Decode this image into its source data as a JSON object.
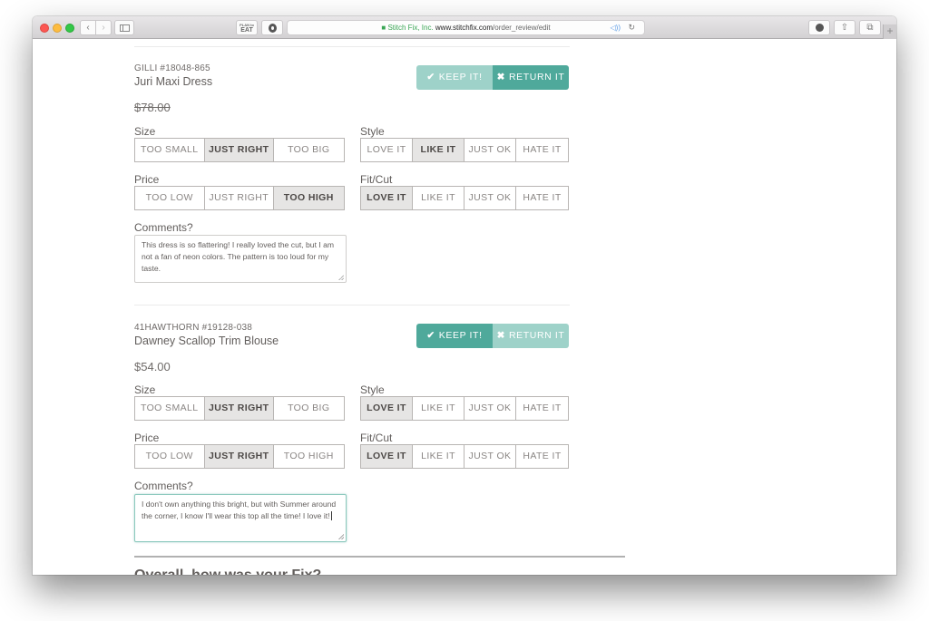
{
  "browser": {
    "address": {
      "company": "Stitch Fix, Inc.",
      "domain": "www.stitchfix.com",
      "path": "/order_review/edit"
    },
    "extension_eat_label": "EAT",
    "extension_eat_small": "PLAN to",
    "icons": {
      "back": "‹",
      "forward": "›",
      "audio": "◁))",
      "reload": "↻",
      "share": "⇧",
      "tabs": "⧉",
      "new_tab": "+",
      "lock": "🔒"
    }
  },
  "items": [
    {
      "sku": "GILLI #18048-865",
      "name": "Juri Maxi Dress",
      "price": "$78.00",
      "price_struck": true,
      "decision": "return",
      "keep_label": "KEEP IT!",
      "return_label": "RETURN IT",
      "size": {
        "label": "Size",
        "options": [
          "TOO SMALL",
          "JUST RIGHT",
          "TOO BIG"
        ],
        "selected": "JUST RIGHT"
      },
      "price_rating": {
        "label": "Price",
        "options": [
          "TOO LOW",
          "JUST RIGHT",
          "TOO HIGH"
        ],
        "selected": "TOO HIGH"
      },
      "style": {
        "label": "Style",
        "options": [
          "LOVE IT",
          "LIKE IT",
          "JUST OK",
          "HATE IT"
        ],
        "selected": "LIKE IT"
      },
      "fit": {
        "label": "Fit/Cut",
        "options": [
          "LOVE IT",
          "LIKE IT",
          "JUST OK",
          "HATE IT"
        ],
        "selected": "LOVE IT"
      },
      "comments_label": "Comments?",
      "comments": "This dress is so flattering! I really loved the cut, but I am not a fan of neon colors. The pattern is too loud for my taste."
    },
    {
      "sku": "41HAWTHORN #19128-038",
      "name": "Dawney Scallop Trim Blouse",
      "price": "$54.00",
      "price_struck": false,
      "decision": "keep",
      "keep_label": "KEEP IT!",
      "return_label": "RETURN IT",
      "size": {
        "label": "Size",
        "options": [
          "TOO SMALL",
          "JUST RIGHT",
          "TOO BIG"
        ],
        "selected": "JUST RIGHT"
      },
      "price_rating": {
        "label": "Price",
        "options": [
          "TOO LOW",
          "JUST RIGHT",
          "TOO HIGH"
        ],
        "selected": "JUST RIGHT"
      },
      "style": {
        "label": "Style",
        "options": [
          "LOVE IT",
          "LIKE IT",
          "JUST OK",
          "HATE IT"
        ],
        "selected": "LOVE IT"
      },
      "fit": {
        "label": "Fit/Cut",
        "options": [
          "LOVE IT",
          "LIKE IT",
          "JUST OK",
          "HATE IT"
        ],
        "selected": "LOVE IT"
      },
      "comments_label": "Comments?",
      "comments": "I don't own anything this bright, but with Summer around the corner, I know I'll wear this top all the time! I love it!"
    }
  ],
  "overall_heading": "Overall, how was your Fix?",
  "colors": {
    "accent_active": "#4fa99b",
    "accent_inactive": "#9ed2c9",
    "selected_bg": "#e6e5e4"
  }
}
